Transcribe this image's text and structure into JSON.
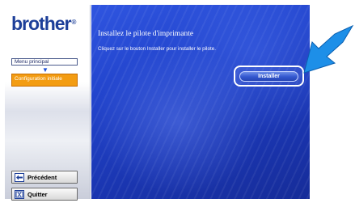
{
  "window": {
    "brand": "brother",
    "brand_dot": "®"
  },
  "sidebar": {
    "menu_label": "Menu principal",
    "step_arrow": "▼",
    "current_step": "Configuration initiale",
    "prev_label": "Précédent",
    "quit_label": "Quitter"
  },
  "main": {
    "title": "Installez le pilote d'imprimante",
    "instruction": "Cliquez sur le bouton Installer pour installer le pilote.",
    "install_label": "Installer"
  },
  "colors": {
    "panel_blue": "#2244cc",
    "accent_orange": "#f39c12",
    "arrow_blue": "#1d8fe8",
    "brand_blue": "#1d3f99"
  }
}
